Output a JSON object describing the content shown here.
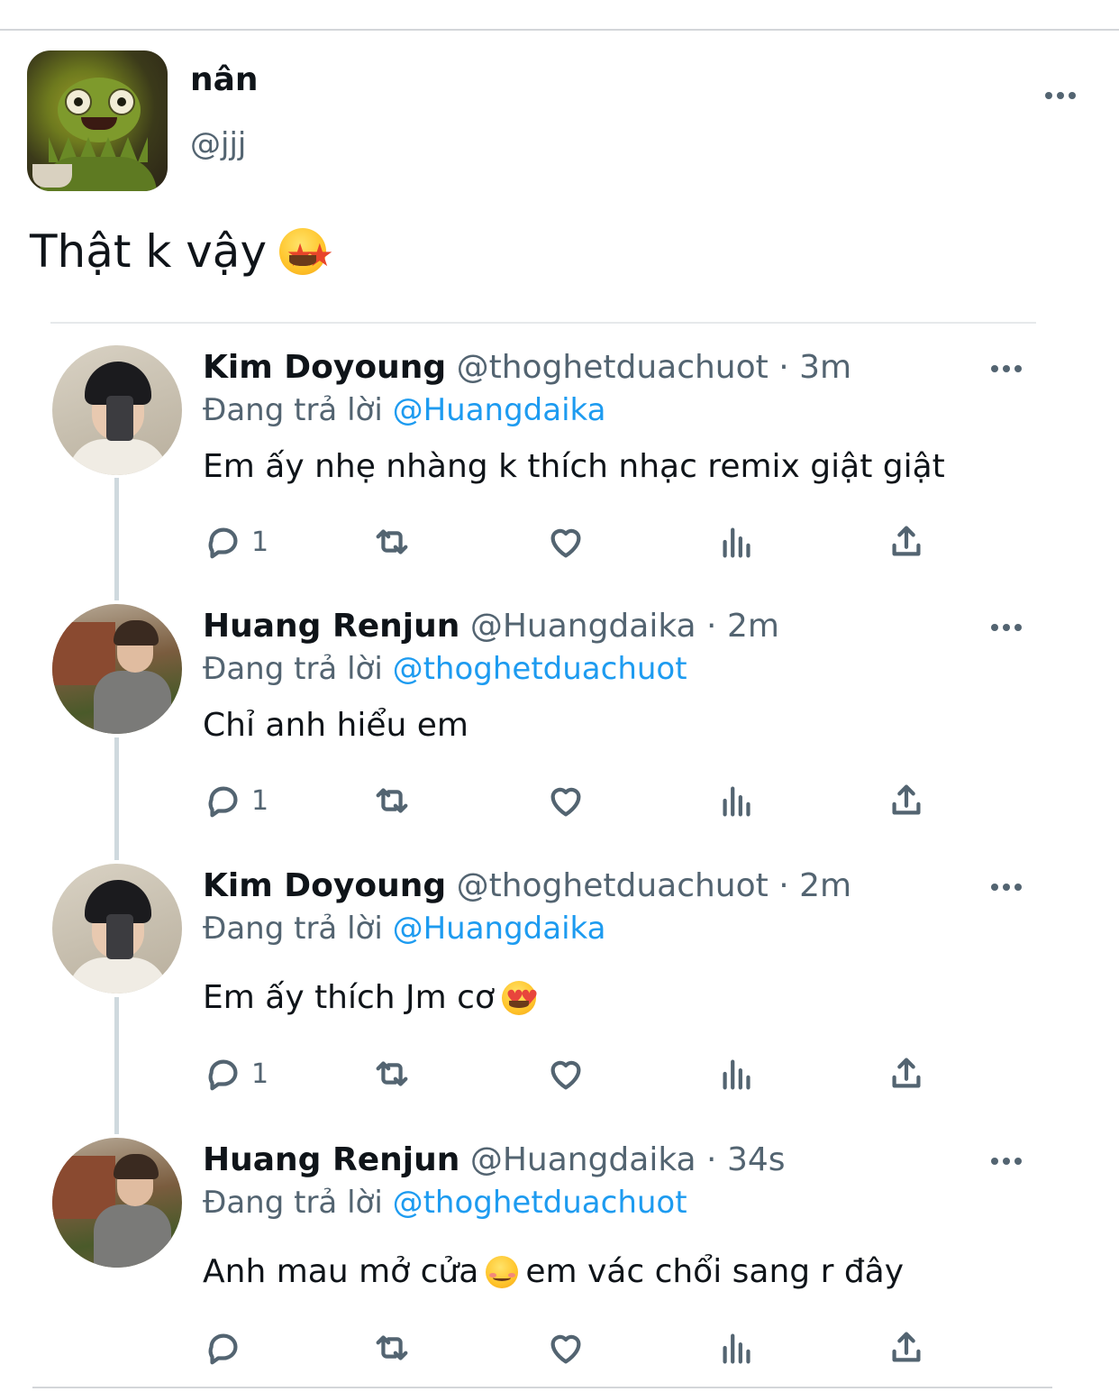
{
  "tweet": {
    "name": "nân",
    "handle": "@jjj",
    "text": "Thật k vậy",
    "emoji": "star-struck-emoji"
  },
  "replies": [
    {
      "name": "Kim Doyoung",
      "meta": "@thoghetduachuot · 3m",
      "replying_label": "Đang trả lời",
      "replying_to": "@Huangdaika",
      "text": "Em ấy nhẹ nhàng k thích nhạc remix giật giật",
      "reply_count": "1",
      "avatar": "kim-avatar"
    },
    {
      "name": "Huang Renjun",
      "meta": "@Huangdaika · 2m",
      "replying_label": "Đang trả lời",
      "replying_to": "@thoghetduachuot",
      "text": "Chỉ anh hiểu em",
      "reply_count": "1",
      "avatar": "huang-avatar"
    },
    {
      "name": "Kim Doyoung",
      "meta": "@thoghetduachuot · 2m",
      "replying_label": "Đang trả lời",
      "replying_to": "@Huangdaika",
      "text": "Em ấy thích Jm cơ",
      "emoji": "heart-eyes-emoji",
      "reply_count": "1",
      "avatar": "kim-avatar"
    },
    {
      "name": "Huang Renjun",
      "meta": "@Huangdaika · 34s",
      "replying_label": "Đang trả lời",
      "replying_to": "@thoghetduachuot",
      "text_before": "Anh mau mở cửa",
      "emoji": "smiling-blush-emoji",
      "text_after": " em vác chổi sang r đây",
      "reply_count": "",
      "avatar": "huang-avatar"
    }
  ],
  "colors": {
    "text": "#0f1419",
    "secondary": "#536471",
    "link": "#1d9bf0",
    "divider": "#e6e9eb"
  }
}
